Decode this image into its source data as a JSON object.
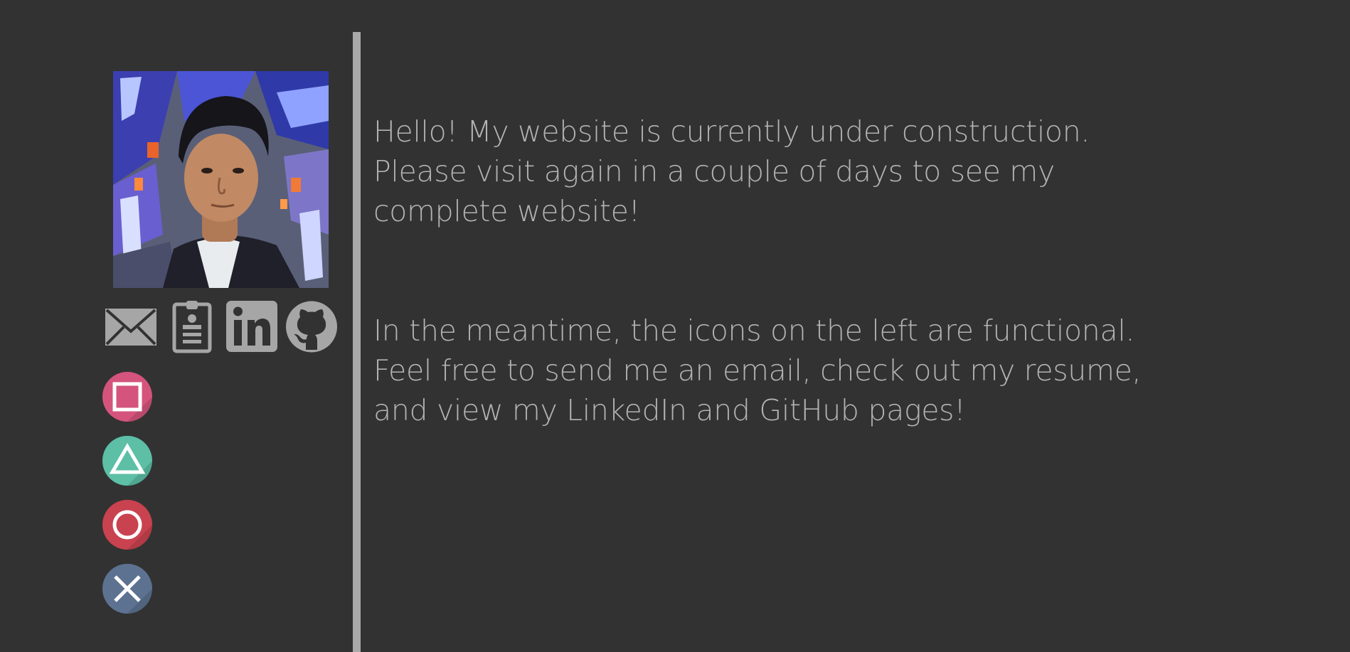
{
  "colors": {
    "background": "#323232",
    "divider": "#a9a9a9",
    "icon_gray": "#a6a6a6",
    "text": "#b3b3b3",
    "square_button": "#d4547d",
    "triangle_button": "#5cbfa6",
    "circle_button": "#c9424f",
    "cross_button": "#5d7291"
  },
  "profile": {
    "avatar_alt": "Profile photo"
  },
  "social_links": [
    {
      "icon": "mail-icon"
    },
    {
      "icon": "resume-document-icon"
    },
    {
      "icon": "linkedin-icon"
    },
    {
      "icon": "github-icon"
    }
  ],
  "ps_buttons": [
    {
      "icon": "square-icon"
    },
    {
      "icon": "triangle-icon"
    },
    {
      "icon": "circle-icon"
    },
    {
      "icon": "cross-icon"
    }
  ],
  "content": {
    "paragraph_1": "Hello! My website is currently under construction.\nPlease visit again in a couple of days to see my\ncomplete website!",
    "paragraph_2": "In the meantime, the icons on the left are functional.\nFeel free to send me an email, check out my resume,\nand view my LinkedIn and GitHub pages!"
  }
}
